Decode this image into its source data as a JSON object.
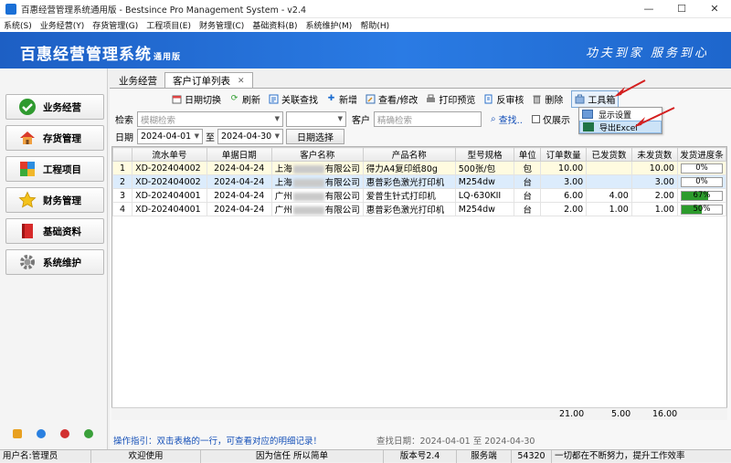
{
  "window": {
    "title": "百惠经营管理系统通用版 - Bestsince Pro Management System - v2.4"
  },
  "window_controls": {
    "minimize": "—",
    "maximize": "☐",
    "close": "✕"
  },
  "menu": [
    "系统(S)",
    "业务经营(Y)",
    "存货管理(G)",
    "工程项目(E)",
    "财务管理(C)",
    "基础资料(B)",
    "系统维护(M)",
    "帮助(H)"
  ],
  "banner": {
    "title": "百惠经营管理系统",
    "edition": "通用版",
    "slogan": "功夫到家 服务到心"
  },
  "sidebar": [
    {
      "label": "业务经营",
      "icon": "check-icon"
    },
    {
      "label": "存货管理",
      "icon": "house-icon"
    },
    {
      "label": "工程项目",
      "icon": "puzzle-icon"
    },
    {
      "label": "财务管理",
      "icon": "star-icon"
    },
    {
      "label": "基础资料",
      "icon": "book-icon"
    },
    {
      "label": "系统维护",
      "icon": "gear-icon"
    }
  ],
  "tabs": [
    {
      "label": "业务经营"
    },
    {
      "label": "客户订单列表"
    }
  ],
  "toolbar": {
    "date_switch": "日期切换",
    "refresh": "刷新",
    "linked_search": "关联查找",
    "add": "新增",
    "view_edit": "查看/修改",
    "print_preview": "打印预览",
    "unapprove": "反审核",
    "delete": "删除",
    "toolbox": "工具箱"
  },
  "toolbox_menu": [
    {
      "label": "显示设置"
    },
    {
      "label": "导出Excel"
    }
  ],
  "search": {
    "label": "检索",
    "placeholder": "模糊检索",
    "customer_label": "客户",
    "customer_placeholder": "精确检索",
    "find": "查找..",
    "show_only": "仅展示",
    "date_label": "日期",
    "date_from": "2024-04-01",
    "to": "至",
    "date_to": "2024-04-30",
    "date_select": "日期选择"
  },
  "table": {
    "columns": [
      "",
      "流水单号",
      "单据日期",
      "客户名称",
      "产品名称",
      "型号规格",
      "单位",
      "订单数量",
      "已发货数",
      "未发货数",
      "发货进度条"
    ],
    "rows": [
      {
        "idx": "1",
        "no": "XD-202404002",
        "date": "2024-04-24",
        "cust_a": "上海",
        "cust_b": "有限公司",
        "product": "得力A4复印纸80g",
        "spec": "500张/包",
        "unit": "包",
        "qty": "10.00",
        "shipped": "",
        "unshipped": "10.00",
        "progress": 0,
        "progress_label": "0%"
      },
      {
        "idx": "2",
        "no": "XD-202404002",
        "date": "2024-04-24",
        "cust_a": "上海",
        "cust_b": "有限公司",
        "product": "惠普彩色激光打印机",
        "spec": "M254dw",
        "unit": "台",
        "qty": "3.00",
        "shipped": "",
        "unshipped": "3.00",
        "progress": 0,
        "progress_label": "0%"
      },
      {
        "idx": "3",
        "no": "XD-202404001",
        "date": "2024-04-24",
        "cust_a": "广州",
        "cust_b": "有限公司",
        "product": "爱普生针式打印机",
        "spec": "LQ-630KII",
        "unit": "台",
        "qty": "6.00",
        "shipped": "4.00",
        "unshipped": "2.00",
        "progress": 0.67,
        "progress_label": "67%"
      },
      {
        "idx": "4",
        "no": "XD-202404001",
        "date": "2024-04-24",
        "cust_a": "广州",
        "cust_b": "有限公司",
        "product": "惠普彩色激光打印机",
        "spec": "M254dw",
        "unit": "台",
        "qty": "2.00",
        "shipped": "1.00",
        "unshipped": "1.00",
        "progress": 0.5,
        "progress_label": "50%"
      }
    ],
    "totals": {
      "qty": "21.00",
      "shipped": "5.00",
      "unshipped": "16.00"
    }
  },
  "hint": "操作指引：双击表格的一行，可查看对应的明细记录！",
  "range": "查找日期：2024-04-01 至 2024-04-30",
  "status": [
    "用户名:管理员",
    "欢迎使用",
    "因为信任 所以简单",
    "版本号2.4",
    "服务端",
    "54320",
    "一切都在不断努力，提升工作效率"
  ],
  "colors": {
    "banner": "#2a7be4",
    "accent_red": "#d42020",
    "progress": "#2c9b2c",
    "row_selected": "#dcecfc",
    "row_first": "#fffbe0"
  }
}
